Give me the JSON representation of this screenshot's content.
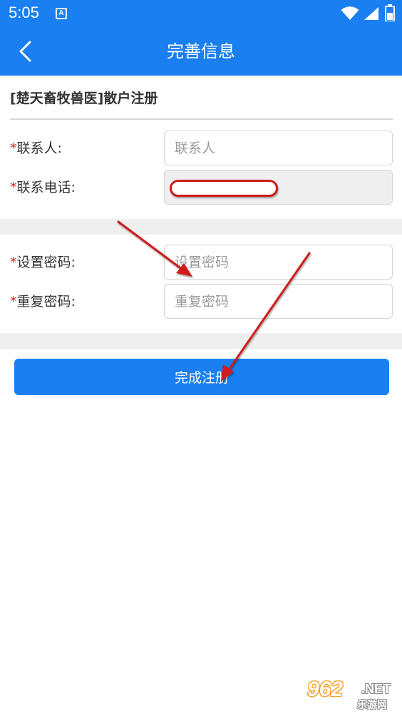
{
  "status_bar": {
    "time": "5:05",
    "notification_icon": "A"
  },
  "app_bar": {
    "title": "完善信息",
    "back_icon": "chevron-left-icon"
  },
  "form": {
    "section_title": "[楚天畜牧兽医]散户注册",
    "required_mark": "*",
    "fields": [
      {
        "label": "联系人:",
        "placeholder": "联系人",
        "value": ""
      },
      {
        "label": "联系电话:",
        "placeholder": "",
        "value": ""
      },
      {
        "label": "设置密码:",
        "placeholder": "设置密码",
        "value": ""
      },
      {
        "label": "重复密码:",
        "placeholder": "重复密码",
        "value": ""
      }
    ],
    "submit_label": "完成注册"
  },
  "watermark": {
    "main": "962",
    "suffix": ".NET",
    "sub": "乐游网"
  },
  "colors": {
    "primary": "#1a7ff0",
    "required": "#e02020",
    "annotation": "#d11a1a",
    "band": "#efefef"
  }
}
